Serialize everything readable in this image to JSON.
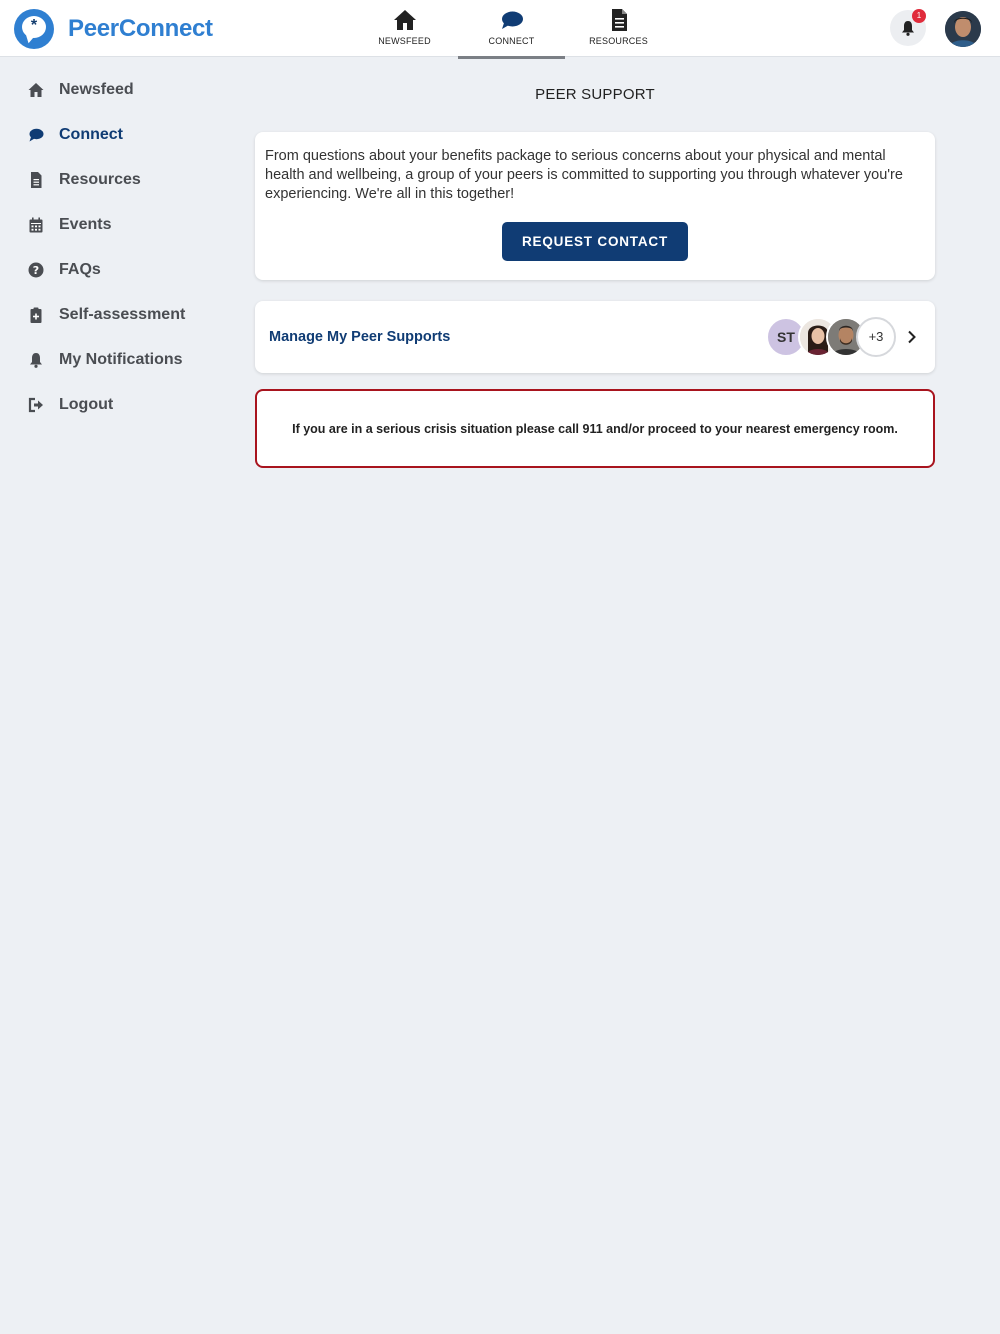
{
  "brand": {
    "name": "PeerConnect",
    "logo_glyph": "*",
    "color": "#2f7fd1"
  },
  "topnav": {
    "items": [
      {
        "label": "NEWSFEED",
        "icon": "home-icon",
        "active": false
      },
      {
        "label": "CONNECT",
        "icon": "chat-bubble-icon",
        "active": true
      },
      {
        "label": "RESOURCES",
        "icon": "document-icon",
        "active": false
      }
    ]
  },
  "header": {
    "notification_count": "1",
    "bell_icon": "bell-icon",
    "avatar": "user-avatar"
  },
  "sidebar": {
    "items": [
      {
        "label": "Newsfeed",
        "icon": "home-icon"
      },
      {
        "label": "Connect",
        "icon": "chat-bubble-icon",
        "active": true
      },
      {
        "label": "Resources",
        "icon": "document-icon"
      },
      {
        "label": "Events",
        "icon": "calendar-icon"
      },
      {
        "label": "FAQs",
        "icon": "question-circle-icon"
      },
      {
        "label": "Self-assessment",
        "icon": "clipboard-plus-icon"
      },
      {
        "label": "My Notifications",
        "icon": "bell-icon"
      },
      {
        "label": "Logout",
        "icon": "logout-icon"
      }
    ]
  },
  "main": {
    "title": "PEER SUPPORT",
    "intro_text": "From questions about your benefits package to serious concerns about your physical and mental health and wellbeing, a group of your peers is committed to supporting you through whatever you're experiencing. We're all in this together!",
    "request_button": "REQUEST CONTACT",
    "manage": {
      "label": "Manage My Peer Supports",
      "initials": "ST",
      "more_count": "+3"
    },
    "crisis_text": "If you are in a serious crisis situation please call 911 and/or proceed to your nearest emergency room."
  },
  "colors": {
    "primary": "#103c74",
    "accent": "#2f7fd1",
    "danger": "#a8141e",
    "badge": "#e02b3b",
    "background": "#edf0f4"
  }
}
